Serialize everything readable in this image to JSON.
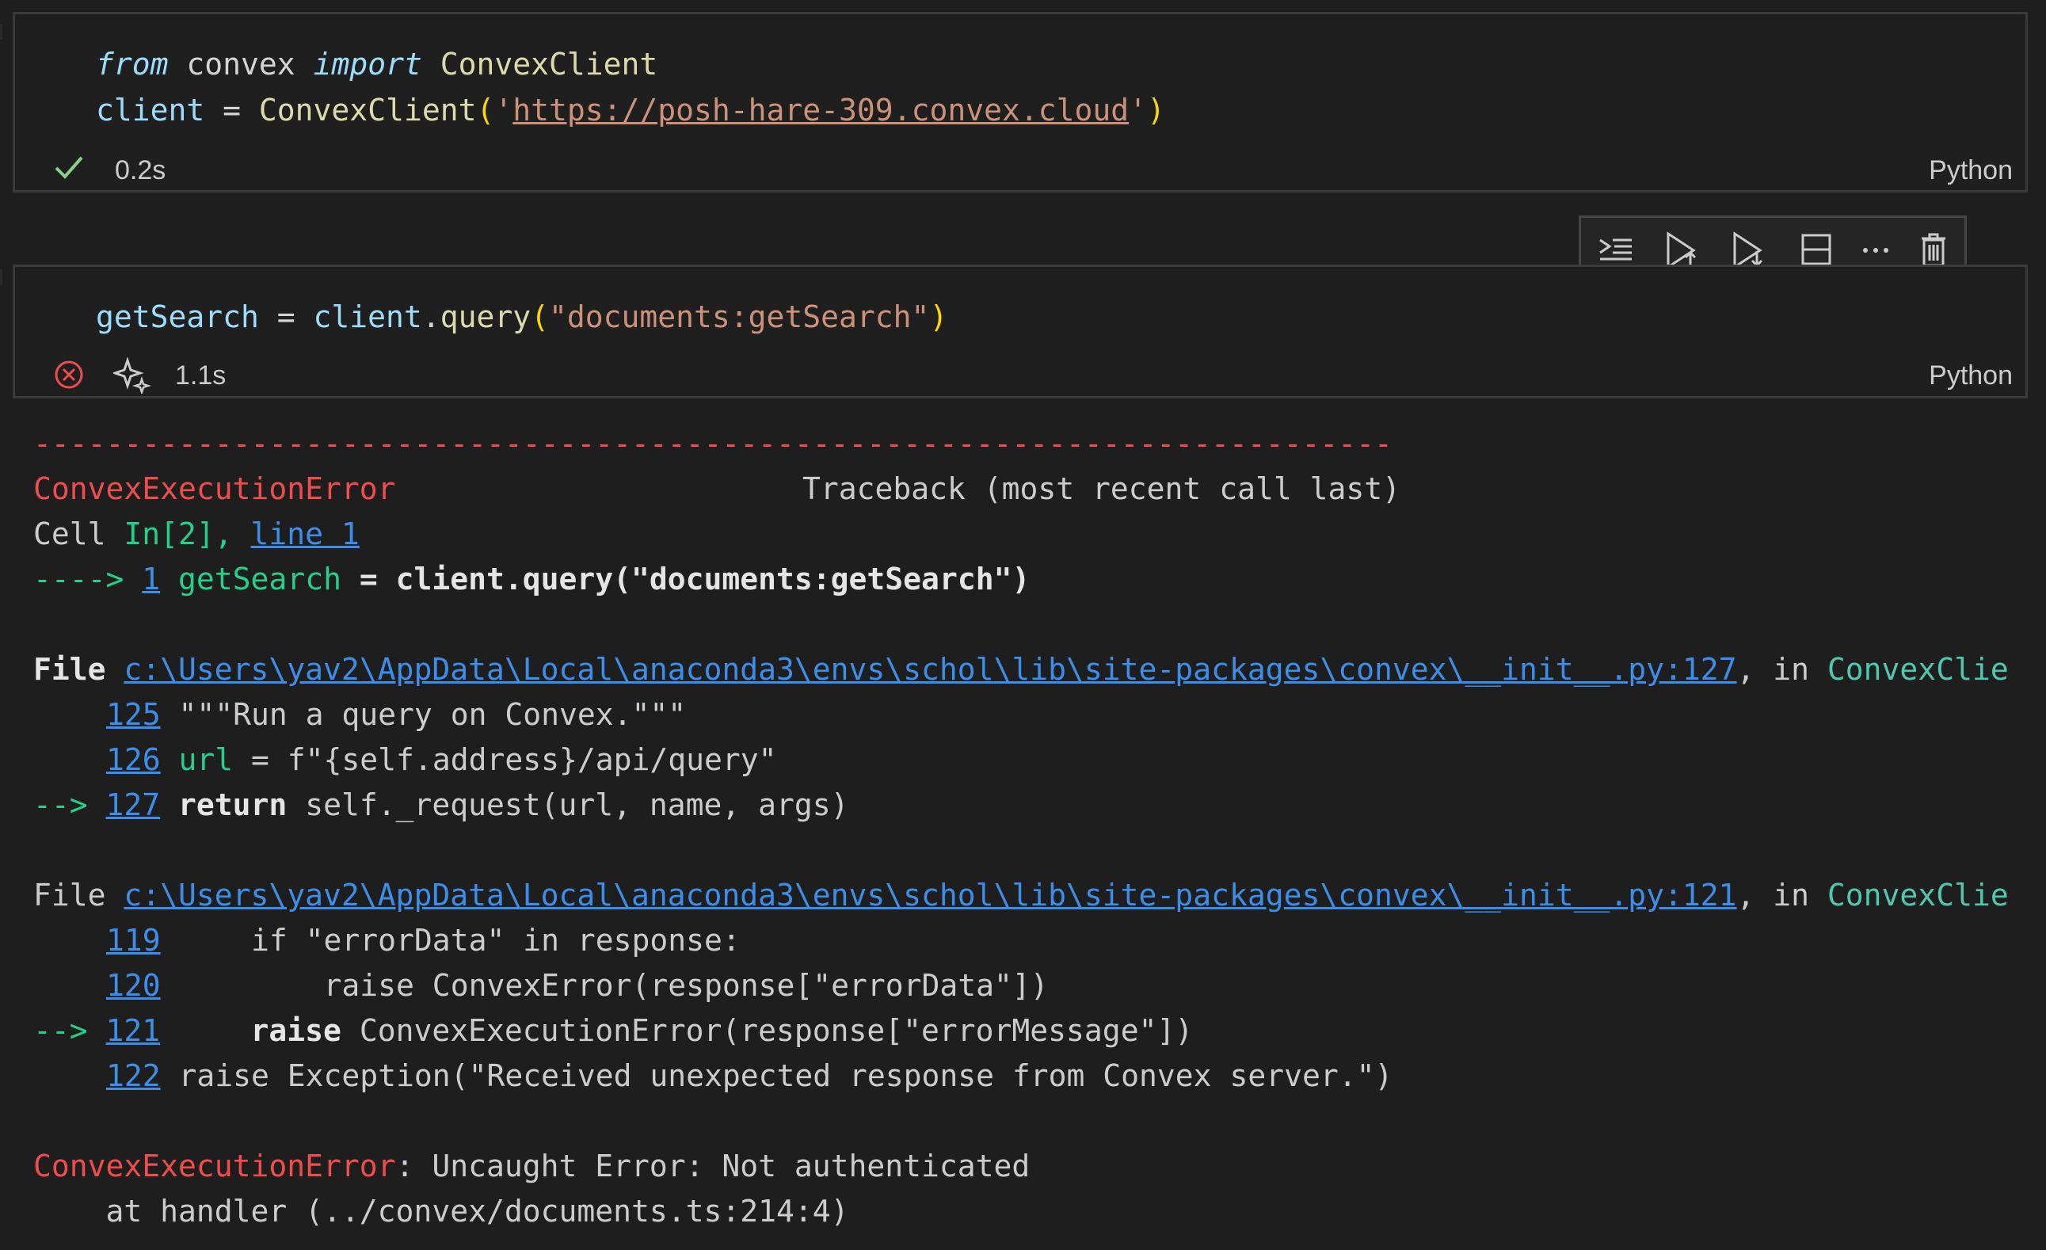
{
  "cell1": {
    "line1": {
      "kw_from": "from",
      "module": "convex",
      "kw_import": "import",
      "cls": "ConvexClient"
    },
    "line2": {
      "var": "client",
      "eq": " = ",
      "fn": "ConvexClient",
      "open": "(",
      "q1": "'",
      "url": "https://posh-hare-309.convex.cloud",
      "q2": "'",
      "close": ")"
    },
    "status_time": "0.2s",
    "language": "Python"
  },
  "toolbar": {
    "buttons": [
      "run-by-line-icon",
      "execute-above-icon",
      "execute-below-icon",
      "split-cell-icon",
      "more-icon",
      "delete-icon"
    ]
  },
  "cell2": {
    "code": {
      "var": "getSearch",
      "eq": " = ",
      "obj": "client",
      "dot": ".",
      "fn": "query",
      "open": "(",
      "str": "\"documents:getSearch\"",
      "close": ")"
    },
    "status_time": "1.1s",
    "language": "Python"
  },
  "output": {
    "dashes": "---------------------------------------------------------------------------",
    "error_name": "ConvexExecutionError",
    "traceback_header": "Traceback (most recent call last)",
    "cell_prefix": "Cell ",
    "cell_in": "In[2], ",
    "cell_line": "line 1",
    "arrow1": "----> ",
    "arrow1_num": "1",
    "arrow1_code_a": " getSearch ",
    "arrow1_code_b": "= client.query(\"documents:getSearch\")",
    "file1_prefix": "File ",
    "file1_path": "c:\\Users\\yav2\\AppData\\Local\\anaconda3\\envs\\schol\\lib\\site-packages\\convex\\__init__.py:127",
    "file1_in": ", in ",
    "file1_fn": "ConvexClie",
    "l125_num": "125",
    "l125_code": " \"\"\"Run a query on Convex.\"\"\"",
    "l126_num": "126",
    "l126_var": " url",
    "l126_code": " = f\"{self.address}/api/query\"",
    "l127_arrow": "--> ",
    "l127_num": "127",
    "l127_kw": " return",
    "l127_code": " self._request(url, name, args)",
    "file2_prefix": "File ",
    "file2_path": "c:\\Users\\yav2\\AppData\\Local\\anaconda3\\envs\\schol\\lib\\site-packages\\convex\\__init__.py:121",
    "file2_in": ", in ",
    "file2_fn": "ConvexClie",
    "l119_num": "119",
    "l119_code": "     if \"errorData\" in response:",
    "l120_num": "120",
    "l120_code": "         raise ConvexError(response[\"errorData\"])",
    "l121_arrow": "--> ",
    "l121_num": "121",
    "l121_kw": "     raise",
    "l121_code": " ConvexExecutionError(response[\"errorMessage\"])",
    "l122_num": "122",
    "l122_code": " raise Exception(\"Received unexpected response from Convex server.\")",
    "final_error_name": "ConvexExecutionError",
    "final_error_msg": ": Uncaught Error: Not authenticated",
    "final_at": "    at handler (../convex/documents.ts:214:4)"
  }
}
